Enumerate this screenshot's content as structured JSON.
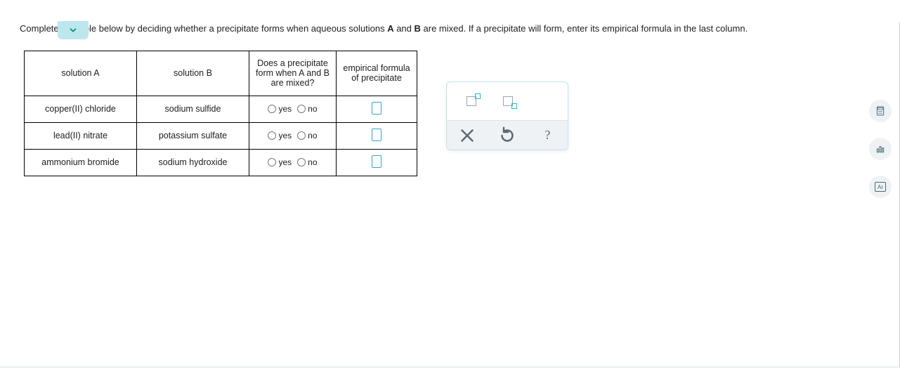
{
  "instruction": {
    "prefix": "Complete the table below by deciding whether a precipitate forms when aqueous solutions ",
    "bA": "A",
    "mid": " and ",
    "bB": "B",
    "suffix": " are mixed. If a precipitate will form, enter its empirical formula in the last column."
  },
  "headers": {
    "colA": "solution A",
    "colB": "solution B",
    "colC": "Does a precipitate form when A and B are mixed?",
    "colD": "empirical formula of precipitate"
  },
  "radio": {
    "yes": "yes",
    "no": "no"
  },
  "rows": [
    {
      "a": "copper(II) chloride",
      "b": "sodium sulfide"
    },
    {
      "a": "lead(II) nitrate",
      "b": "potassium sulfate"
    },
    {
      "a": "ammonium bromide",
      "b": "sodium hydroxide"
    }
  ],
  "toolbar": {
    "close": "×",
    "reset": "↺",
    "help": "?"
  },
  "rail": {
    "ar": "Ar"
  }
}
